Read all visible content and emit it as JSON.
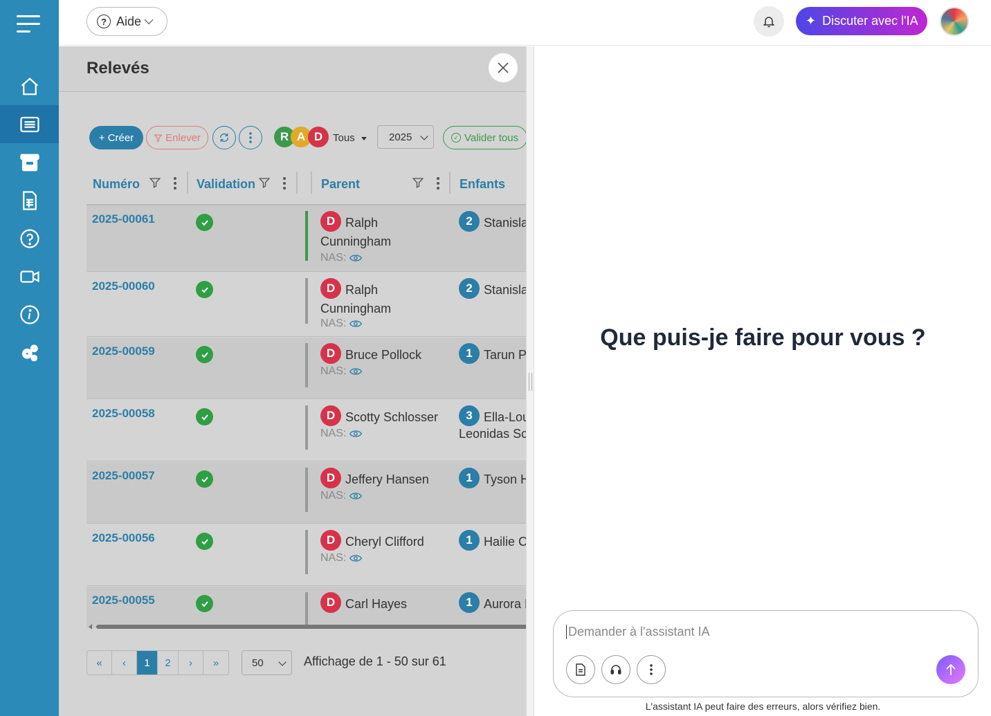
{
  "topbar": {
    "help_label": "Aide",
    "ai_button_label": "Discuter avec l'IA"
  },
  "main": {
    "title": "Relevés",
    "toolbar": {
      "create_label": "+ Créer",
      "remove_label": "Enlever",
      "badges": [
        "R",
        "A",
        "D"
      ],
      "filter_label": "Tous",
      "year_value": "2025",
      "validate_all_label": "Valider tous"
    },
    "columns": [
      "Numéro",
      "Validation",
      "Parent",
      "Enfants"
    ],
    "nas_label": "NAS:",
    "rows": [
      {
        "num": "2025-00061",
        "parent_badge": "D",
        "parent": "Ralph Cunningham",
        "child_count": "2",
        "children": "Stanisla"
      },
      {
        "num": "2025-00060",
        "parent_badge": "D",
        "parent": "Ralph Cunningham",
        "child_count": "2",
        "children": "Stanisla"
      },
      {
        "num": "2025-00059",
        "parent_badge": "D",
        "parent": "Bruce Pollock",
        "child_count": "1",
        "children": "Tarun P"
      },
      {
        "num": "2025-00058",
        "parent_badge": "D",
        "parent": "Scotty Schlosser",
        "child_count": "3",
        "children": "Ella-Lou",
        "children_line2": "Leonidas Sc"
      },
      {
        "num": "2025-00057",
        "parent_badge": "D",
        "parent": "Jeffery Hansen",
        "child_count": "1",
        "children": "Tyson H"
      },
      {
        "num": "2025-00056",
        "parent_badge": "D",
        "parent": "Cheryl Clifford",
        "child_count": "1",
        "children": "Hailie C"
      },
      {
        "num": "2025-00055",
        "parent_badge": "D",
        "parent": "Carl Hayes",
        "child_count": "1",
        "children": "Aurora H"
      }
    ],
    "pager": {
      "pages": [
        "1",
        "2"
      ],
      "current": "1",
      "page_size": "50",
      "info": "Affichage de 1 - 50 sur 61"
    }
  },
  "chat": {
    "welcome": "Que puis-je faire pour vous ?",
    "input_placeholder": "Demander à l'assistant IA",
    "disclaimer": "L'assistant IA peut faire des erreurs, alors vérifiez bien."
  },
  "colors": {
    "sidebar": "#2b8ab8",
    "sidebar_active": "#1e73a8",
    "accent": "#2b7ea8",
    "success": "#2f9e44",
    "danger_badge": "#d6334a",
    "badge_r": "#3a9a4a",
    "badge_a": "#e0a92a",
    "ai_gradient_start": "#4f46e5",
    "ai_gradient_end": "#c026d3"
  },
  "icons": {
    "sidebar": [
      "home-icon",
      "list-icon",
      "archive-icon",
      "spreadsheet-icon",
      "help-icon",
      "video-icon",
      "info-icon",
      "settings-icon"
    ],
    "topbar": [
      "menu-icon",
      "bell-icon",
      "sparkle-icon"
    ],
    "chat_tools": [
      "document-icon",
      "headset-icon",
      "more-vertical-icon",
      "arrow-up-icon"
    ]
  }
}
